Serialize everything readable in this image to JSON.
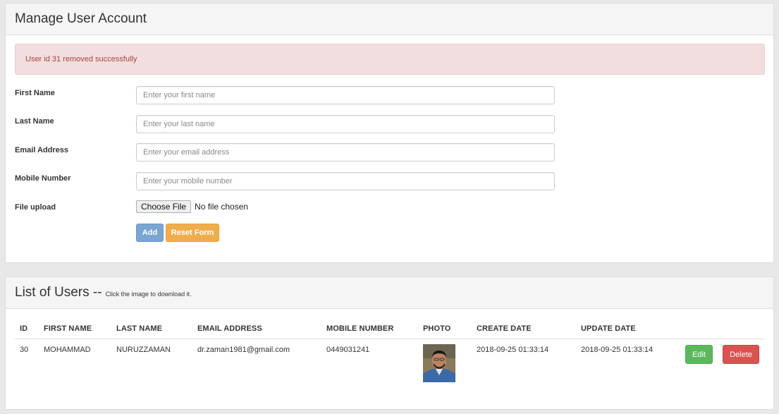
{
  "form_panel": {
    "title": "Manage User Account",
    "alert": "User id 31 removed successfully",
    "fields": {
      "first_name": {
        "label": "First Name",
        "placeholder": "Enter your first name"
      },
      "last_name": {
        "label": "Last Name",
        "placeholder": "Enter your last name"
      },
      "email": {
        "label": "Email Address",
        "placeholder": "Enter your email address"
      },
      "mobile": {
        "label": "Mobile Number",
        "placeholder": "Enter your mobile number"
      },
      "file": {
        "label": "File upload",
        "button": "Choose File",
        "status": "No file chosen"
      }
    },
    "buttons": {
      "add": "Add",
      "reset": "Reset Form"
    }
  },
  "list_panel": {
    "title": "List of Users --",
    "hint": "Click the image to download it.",
    "columns": {
      "id": "ID",
      "first_name": "FIRST NAME",
      "last_name": "LAST NAME",
      "email": "EMAIL ADDRESS",
      "mobile": "MOBILE NUMBER",
      "photo": "PHOTO",
      "create_date": "CREATE DATE",
      "update_date": "UPDATE DATE"
    },
    "rows": [
      {
        "id": "30",
        "first_name": "MOHAMMAD",
        "last_name": "NURUZZAMAN",
        "email": "dr.zaman1981@gmail.com",
        "mobile": "0449031241",
        "photo": "user-photo",
        "create_date": "2018-09-25 01:33:14",
        "update_date": "2018-09-25 01:33:14",
        "edit_label": "Edit",
        "delete_label": "Delete"
      }
    ]
  },
  "colors": {
    "alert_bg": "#f2dede",
    "alert_text": "#a94442",
    "add_button": "#7aa6d3",
    "reset_button": "#f0ad4e",
    "edit_button": "#5cb85c",
    "delete_button": "#d9534f"
  }
}
